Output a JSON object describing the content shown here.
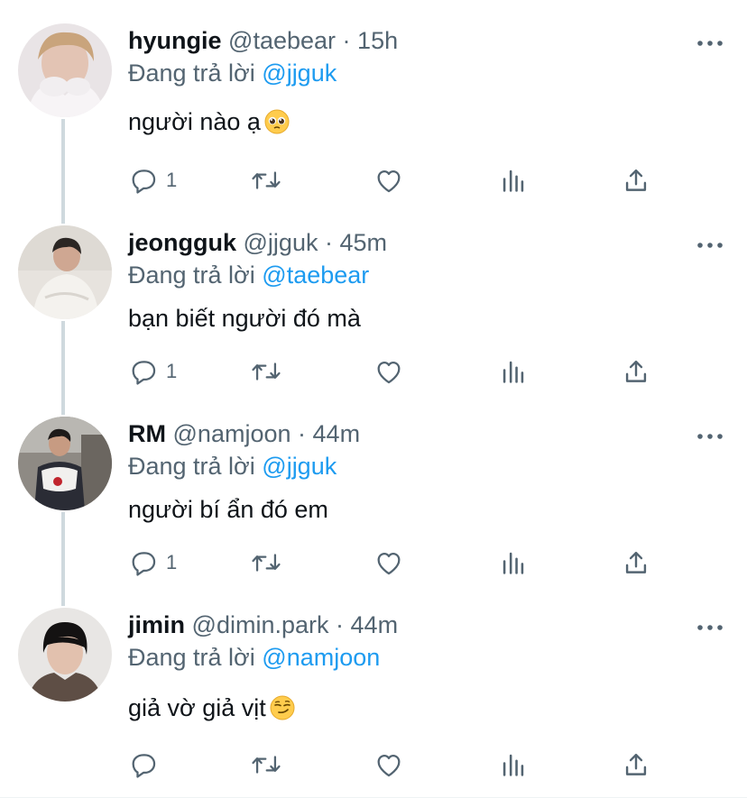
{
  "tweets": [
    {
      "name": "hyungie",
      "handle": "@taebear",
      "time": "15h",
      "replying_label": "Đang trả lời",
      "replying_to": "@jjguk",
      "text": "người nào ạ",
      "emoji": "pleading-face",
      "reply_count": "1"
    },
    {
      "name": "jeongguk",
      "handle": "@jjguk",
      "time": "45m",
      "replying_label": "Đang trả lời",
      "replying_to": "@taebear",
      "text": "bạn biết người đó mà",
      "reply_count": "1"
    },
    {
      "name": "RM",
      "handle": "@namjoon",
      "time": "44m",
      "replying_label": "Đang trả lời",
      "replying_to": "@jjguk",
      "text": "người bí ẩn đó em",
      "reply_count": "1"
    },
    {
      "name": "jimin",
      "handle": "@dimin.park",
      "time": "44m",
      "replying_label": "Đang trả lời",
      "replying_to": "@namjoon",
      "text": "giả vờ giả vịt",
      "emoji": "smirking-face",
      "reply_count": ""
    }
  ],
  "separator": "·",
  "colors": {
    "text": "#0f1419",
    "secondary": "#536471",
    "mention": "#1d9bf0",
    "thread_line": "#cfd9de"
  },
  "icons": [
    "reply-icon",
    "retweet-icon",
    "like-icon",
    "views-icon",
    "share-icon",
    "more-icon"
  ]
}
